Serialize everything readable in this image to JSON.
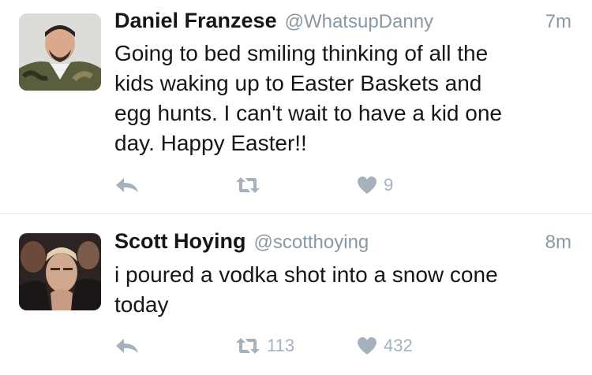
{
  "tweets": [
    {
      "name": "Daniel Franzese",
      "handle": "@WhatsupDanny",
      "time": "7m",
      "text": "Going to bed smiling thinking of all the\nkids waking up to Easter Baskets and\negg hunts. I can't wait to have a kid one\nday. Happy Easter!!",
      "retweets": "",
      "likes": "9"
    },
    {
      "name": "Scott Hoying",
      "handle": "@scotthoying",
      "time": "8m",
      "text": "i poured a vodka shot into a snow cone\ntoday",
      "retweets": "113",
      "likes": "432"
    }
  ],
  "icons": {
    "reply": "reply-icon",
    "retweet": "retweet-icon",
    "like": "heart-icon"
  },
  "colors": {
    "text": "#14171a",
    "secondary": "#8899a6",
    "action": "#a5b2bd",
    "divider": "#e1e8ed"
  }
}
